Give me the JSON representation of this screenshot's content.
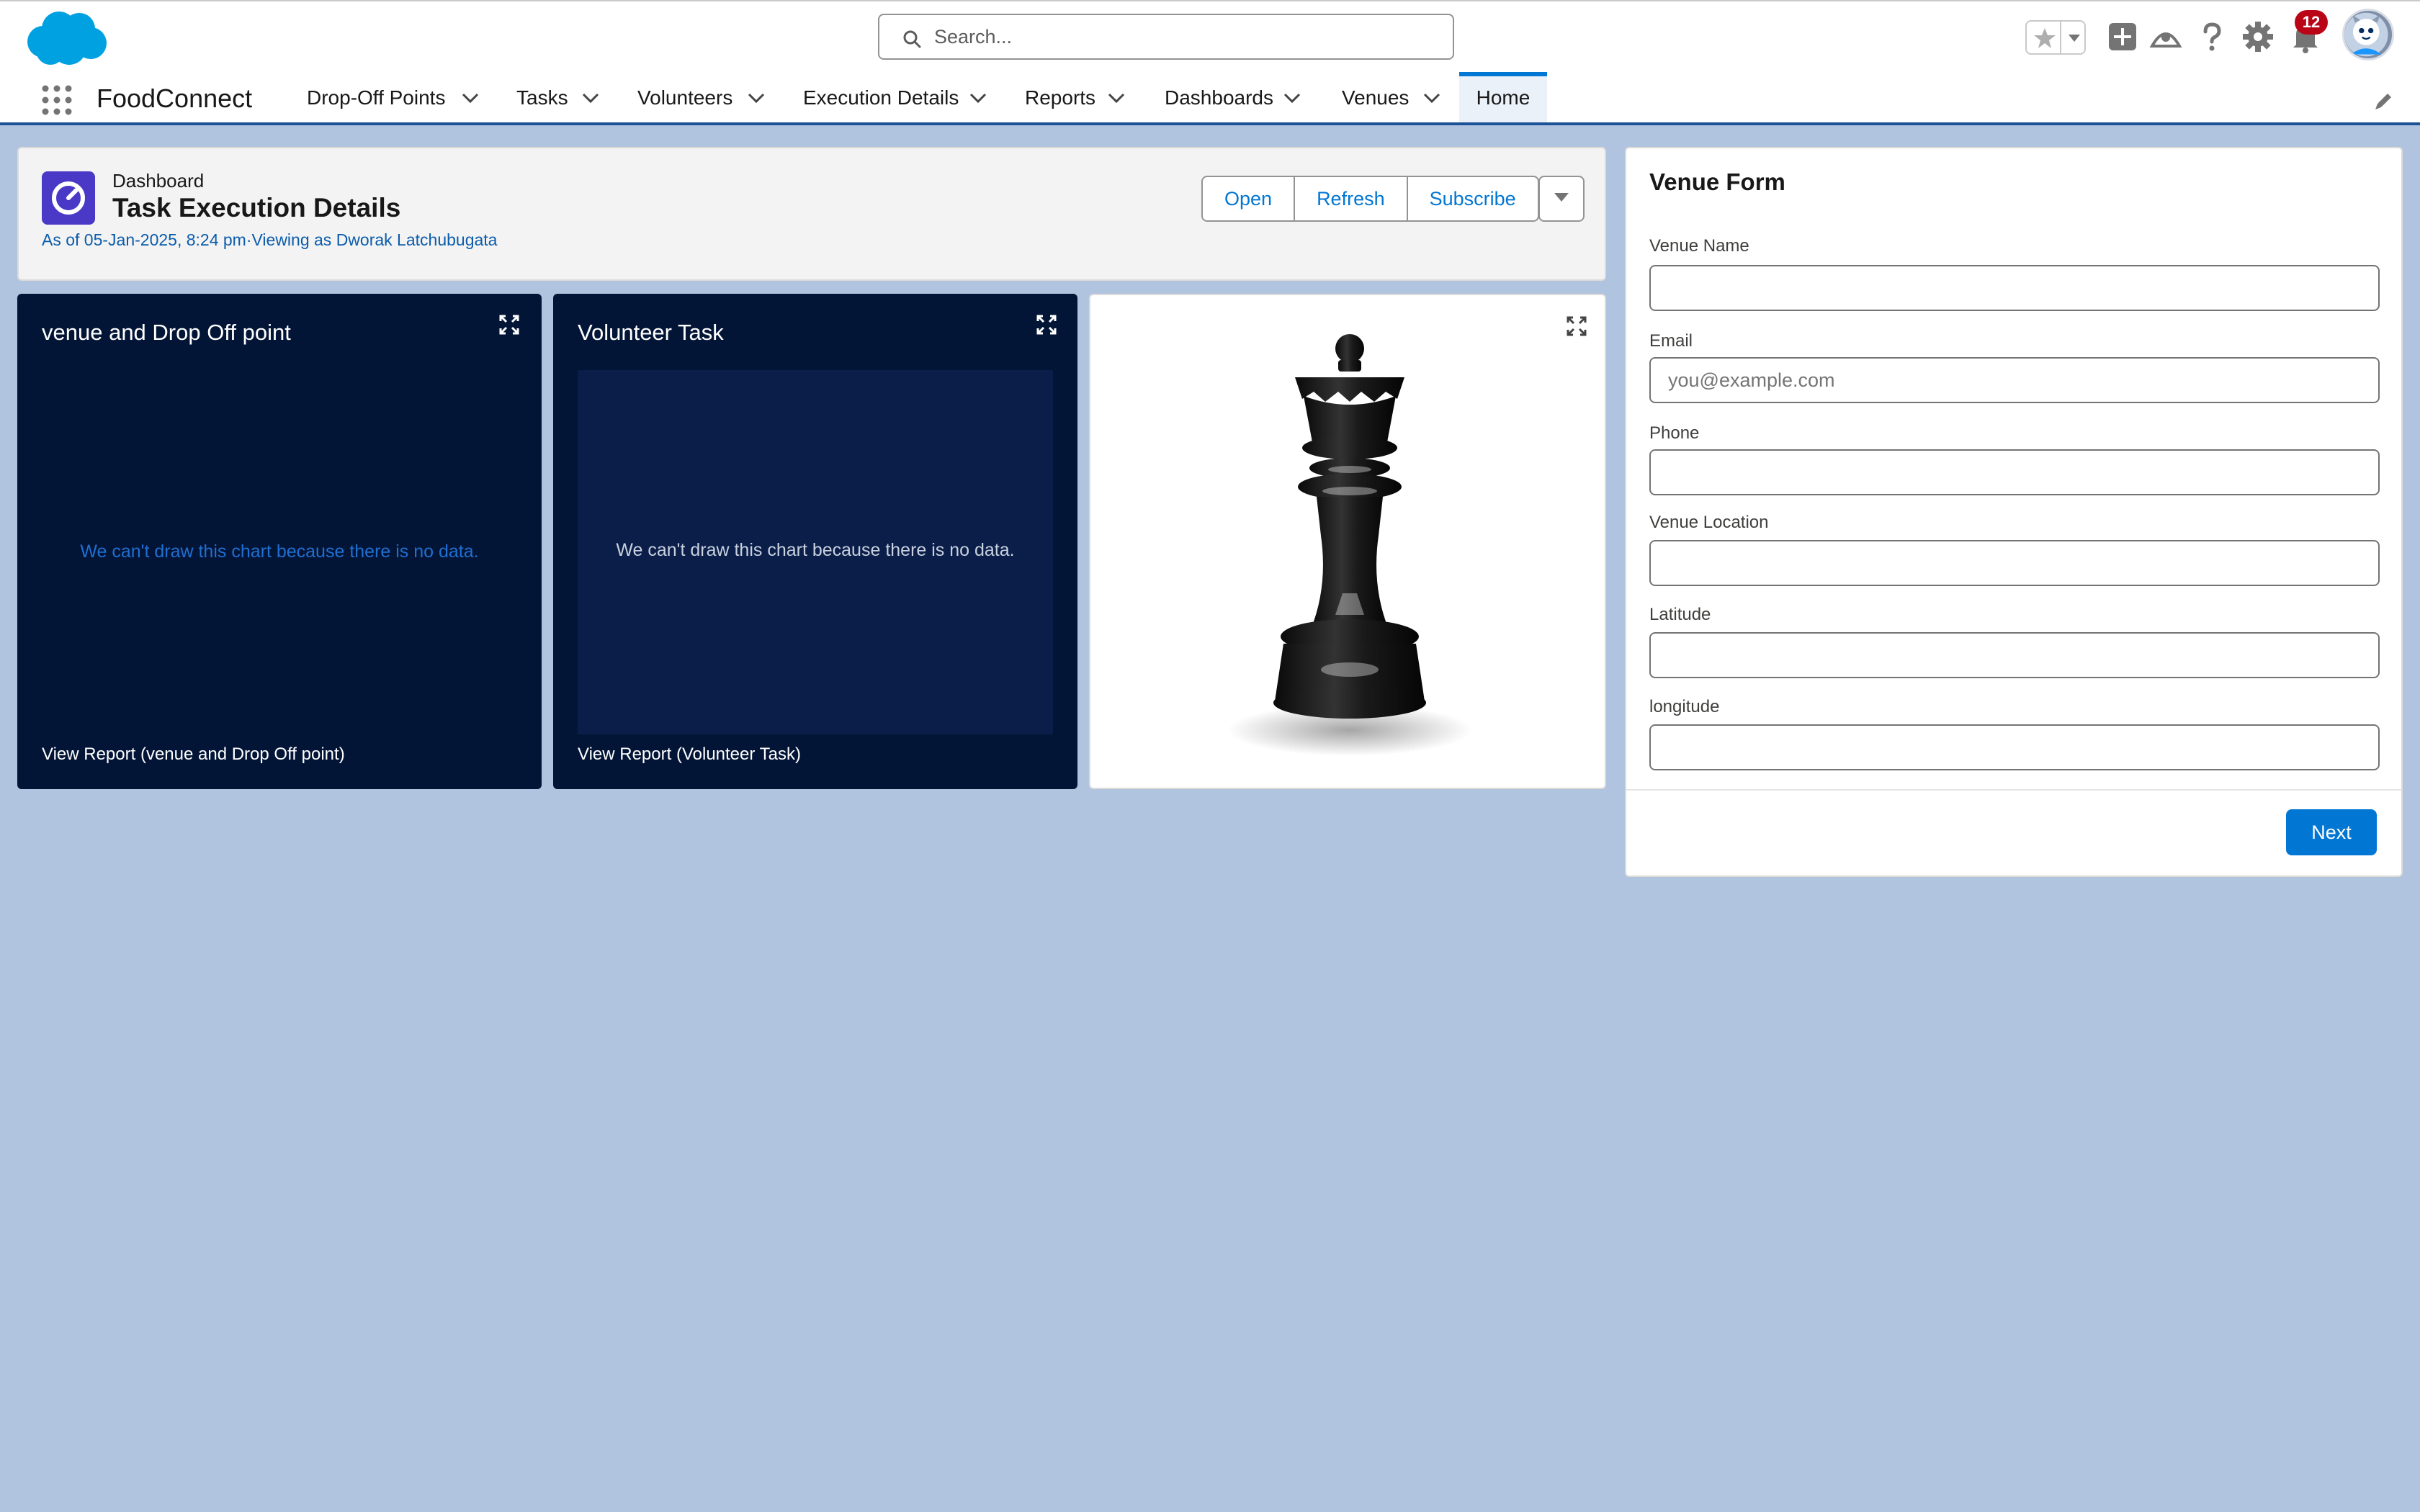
{
  "header": {
    "search_placeholder": "Search...",
    "notification_count": "12",
    "icons": [
      "salesforce-cloud-logo",
      "search-icon",
      "star-icon",
      "chevron-down-icon",
      "add-icon",
      "trailhead-icon",
      "help-icon",
      "gear-icon",
      "bell-icon",
      "avatar"
    ]
  },
  "nav": {
    "app_name": "FoodConnect",
    "items": [
      {
        "label": "Drop-Off Points"
      },
      {
        "label": "Tasks"
      },
      {
        "label": "Volunteers"
      },
      {
        "label": "Execution Details"
      },
      {
        "label": "Reports"
      },
      {
        "label": "Dashboards"
      },
      {
        "label": "Venues"
      }
    ],
    "home_label": "Home"
  },
  "dashboard": {
    "kind": "Dashboard",
    "title": "Task Execution Details",
    "meta": "As of 05-Jan-2025, 8:24 pm·Viewing as Dworak Latchubugata",
    "buttons": {
      "open": "Open",
      "refresh": "Refresh",
      "subscribe": "Subscribe"
    },
    "widgets": [
      {
        "title": "venue and Drop Off point",
        "no_data": "We can't draw this chart because there is no data.",
        "link": "View Report (venue and Drop Off point)"
      },
      {
        "title": "Volunteer Task",
        "no_data": "We can't draw this chart because there is no data.",
        "link": "View Report (Volunteer Task)"
      },
      {
        "image": "chess-queen-image"
      }
    ]
  },
  "venue_form": {
    "title": "Venue Form",
    "fields": [
      {
        "label": "Venue Name",
        "value": "",
        "placeholder": ""
      },
      {
        "label": "Email",
        "value": "",
        "placeholder": "you@example.com"
      },
      {
        "label": "Phone",
        "value": "",
        "placeholder": ""
      },
      {
        "label": "Venue Location",
        "value": "",
        "placeholder": ""
      },
      {
        "label": "Latitude",
        "value": "",
        "placeholder": ""
      },
      {
        "label": "longitude",
        "value": "",
        "placeholder": ""
      }
    ],
    "next_label": "Next"
  },
  "colors": {
    "brand": "#0176d3",
    "page_bg": "#b0c4df",
    "widget_dark": "#031536",
    "badge": "#ba0517"
  }
}
